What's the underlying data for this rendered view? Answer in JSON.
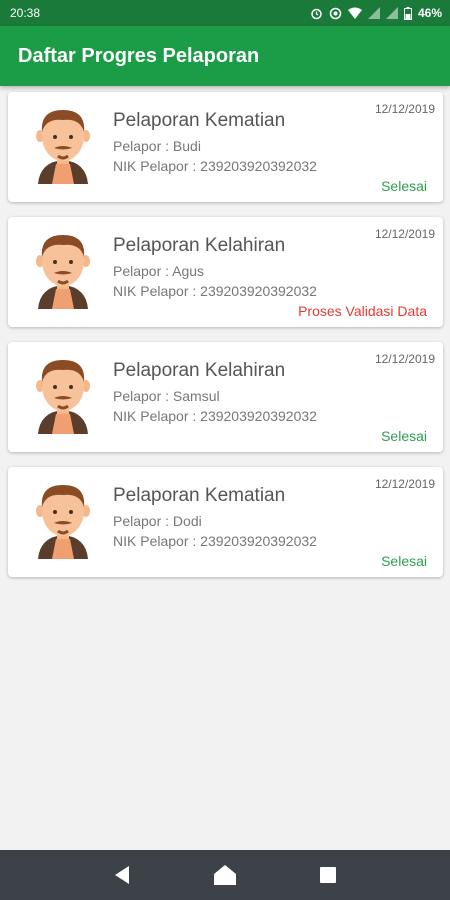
{
  "status_bar": {
    "time": "20:38",
    "battery": "46%"
  },
  "app_bar": {
    "title": "Daftar Progres Pelaporan"
  },
  "colors": {
    "primary": "#1b9c47",
    "primary_dark": "#1a7a39",
    "done": "#2e9e4f",
    "pending": "#e53935"
  },
  "reports": [
    {
      "title": "Pelaporan Kematian",
      "reporter": "Pelapor : Budi",
      "nik": "NIK Pelapor : 239203920392032",
      "date": "12/12/2019",
      "status": "Selesai",
      "status_type": "done"
    },
    {
      "title": "Pelaporan Kelahiran",
      "reporter": "Pelapor : Agus",
      "nik": "NIK Pelapor : 239203920392032",
      "date": "12/12/2019",
      "status": "Proses Validasi Data",
      "status_type": "pending"
    },
    {
      "title": "Pelaporan Kelahiran",
      "reporter": "Pelapor : Samsul",
      "nik": "NIK Pelapor : 239203920392032",
      "date": "12/12/2019",
      "status": "Selesai",
      "status_type": "done"
    },
    {
      "title": "Pelaporan Kematian",
      "reporter": "Pelapor : Dodi",
      "nik": "NIK Pelapor : 239203920392032",
      "date": "12/12/2019",
      "status": "Selesai",
      "status_type": "done"
    }
  ],
  "nav": {
    "back_icon": "back-icon",
    "home_icon": "home-icon",
    "recents_icon": "recents-icon"
  }
}
